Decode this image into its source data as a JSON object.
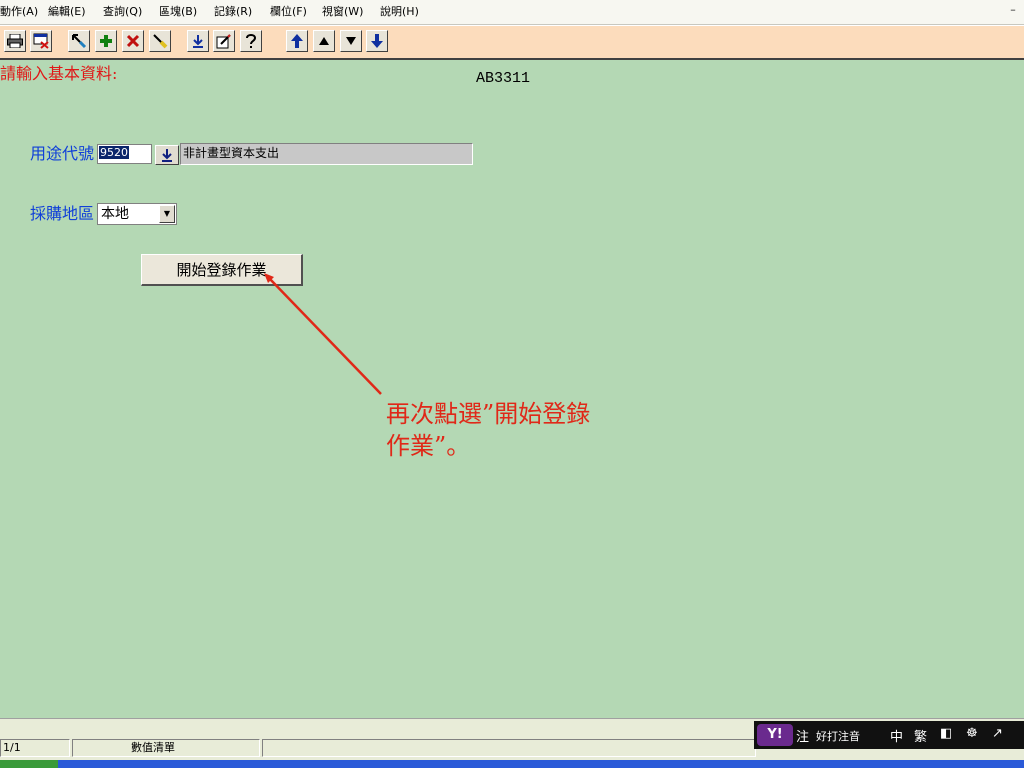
{
  "menu": [
    "動作(A)",
    "編輯(E)",
    "查詢(Q)",
    "區塊(B)",
    "記錄(R)",
    "欄位(F)",
    "視窗(W)",
    "說明(H)"
  ],
  "window_minimize": "–",
  "toolbar": {
    "icons": [
      "print-icon",
      "cancel-query-icon",
      "query-icon",
      "add-record-icon",
      "delete-record-icon",
      "clear-icon",
      "save-icon",
      "edit-icon",
      "help-icon",
      "first-record-icon",
      "previous-record-icon",
      "next-record-icon",
      "last-record-icon"
    ]
  },
  "form": {
    "prompt": "請輸入基本資料:",
    "code": "AB3311",
    "usage_label": "用途代號",
    "usage_value": "9520",
    "usage_description": "非計畫型資本支出",
    "region_label": "採購地區",
    "region_value": "本地",
    "start_button": "開始登錄作業"
  },
  "annotation": {
    "line1": "再次點選”開始登錄",
    "line2": "作業”。",
    "color": "#e02818"
  },
  "status": {
    "record": "1/1",
    "list": "數值清單"
  },
  "ime": {
    "items": [
      "注",
      "好打注音",
      "中",
      "繁",
      "◧",
      "☸",
      "↗"
    ]
  }
}
